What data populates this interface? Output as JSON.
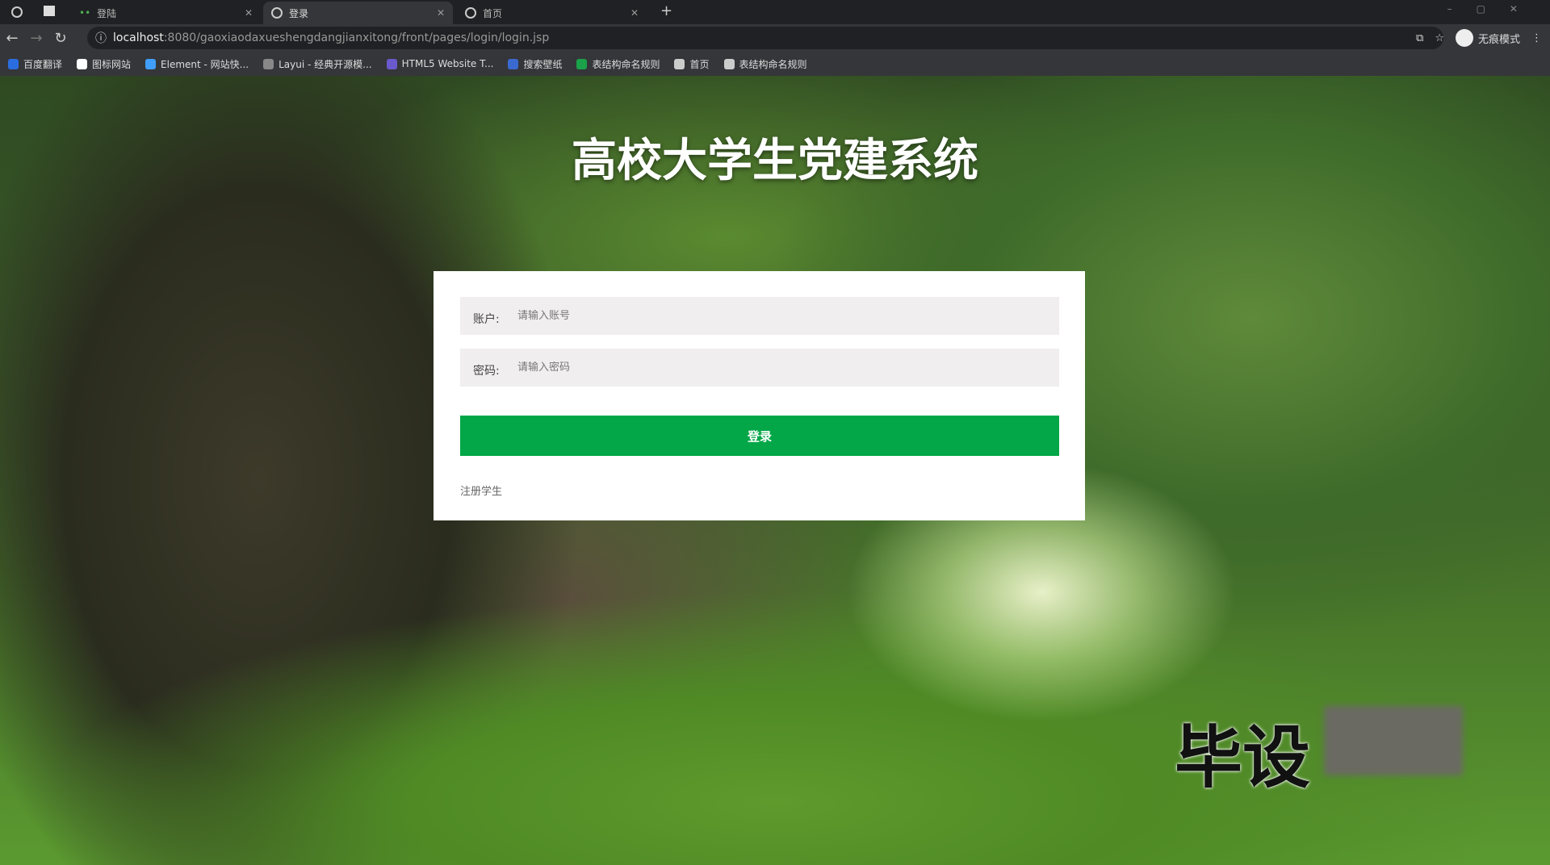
{
  "browser": {
    "tabs": [
      {
        "label": "登陆",
        "active": false
      },
      {
        "label": "登录",
        "active": true
      },
      {
        "label": "首页",
        "active": false
      }
    ],
    "new_tab": "+",
    "url_host": "localhost",
    "url_path": ":8080/gaoxiaodaxueshengdangjianxitong/front/pages/login/login.jsp",
    "profile_label": "无痕模式",
    "bookmarks": [
      {
        "label": "百度翻译",
        "color": "#2a6de0"
      },
      {
        "label": "图标网站",
        "color": "#ffffff"
      },
      {
        "label": "Element - 网站快...",
        "color": "#409eff"
      },
      {
        "label": "Layui - 经典开源模...",
        "color": "#888888"
      },
      {
        "label": "HTML5 Website T...",
        "color": "#6a5acd"
      },
      {
        "label": "搜索壁纸",
        "color": "#3a6ad0"
      },
      {
        "label": "表结构命名规则",
        "color": "#1aa34a"
      },
      {
        "label": "首页",
        "color": "#cccccc"
      },
      {
        "label": "表结构命名规则",
        "color": "#cccccc"
      }
    ]
  },
  "page": {
    "title": "高校大学生党建系统",
    "account_label": "账户:",
    "account_placeholder": "请输入账号",
    "password_label": "密码:",
    "password_placeholder": "请输入密码",
    "login_button": "登录",
    "register_link": "注册学生",
    "accent": "#03a748",
    "watermark": "毕设"
  }
}
